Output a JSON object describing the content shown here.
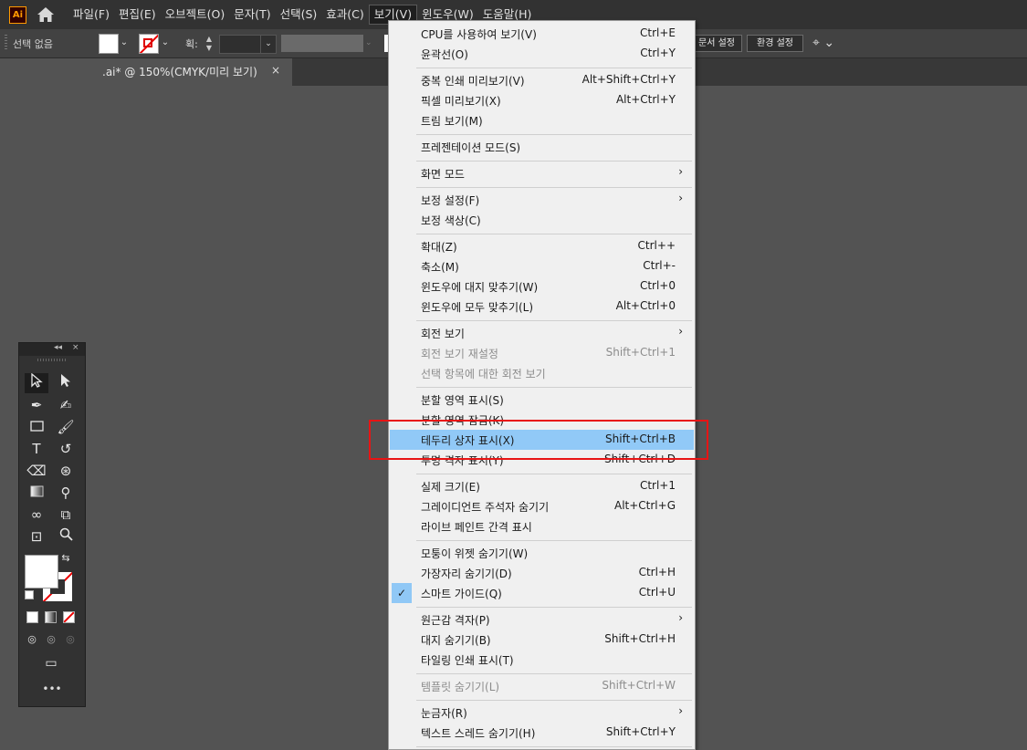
{
  "app": {
    "logo": "Ai"
  },
  "menubar": {
    "items": [
      "파일(F)",
      "편집(E)",
      "오브젝트(O)",
      "문자(T)",
      "선택(S)",
      "효과(C)",
      "보기(V)",
      "윈도우(W)",
      "도움말(H)"
    ]
  },
  "controlbar": {
    "selection_label": "선택 없음",
    "stroke_label": "획:",
    "doc_setup_button": "문서 설정",
    "preferences_button": "환경 설정"
  },
  "tab": {
    "title": ".ai* @ 150%(CMYK/미리 보기)",
    "close": "×"
  },
  "tools_panel": {
    "collapse": "◂◂",
    "close": "×",
    "more": "•••"
  },
  "view_menu": {
    "items": [
      {
        "label": "CPU를 사용하여 보기(V)",
        "shortcut": "Ctrl+E"
      },
      {
        "label": "윤곽선(O)",
        "shortcut": "Ctrl+Y"
      },
      {
        "label": "중복 인쇄 미리보기(V)",
        "shortcut": "Alt+Shift+Ctrl+Y"
      },
      {
        "label": "픽셀 미리보기(X)",
        "shortcut": "Alt+Ctrl+Y"
      },
      {
        "label": "트림 보기(M)",
        "shortcut": ""
      },
      {
        "label": "프레젠테이션 모드(S)",
        "shortcut": ""
      },
      {
        "label": "화면 모드",
        "shortcut": ""
      },
      {
        "label": "보정 설정(F)",
        "shortcut": ""
      },
      {
        "label": "보정 색상(C)",
        "shortcut": ""
      },
      {
        "label": "확대(Z)",
        "shortcut": "Ctrl++"
      },
      {
        "label": "축소(M)",
        "shortcut": "Ctrl+-"
      },
      {
        "label": "윈도우에 대지 맞추기(W)",
        "shortcut": "Ctrl+0"
      },
      {
        "label": "윈도우에 모두 맞추기(L)",
        "shortcut": "Alt+Ctrl+0"
      },
      {
        "label": "회전 보기",
        "shortcut": ""
      },
      {
        "label": "회전 보기 재설정",
        "shortcut": "Shift+Ctrl+1"
      },
      {
        "label": "선택 항목에 대한 회전 보기",
        "shortcut": ""
      },
      {
        "label": "분할 영역 표시(S)",
        "shortcut": ""
      },
      {
        "label": "분할 영역 잠금(K)",
        "shortcut": ""
      },
      {
        "label": "테두리 상자 표시(X)",
        "shortcut": "Shift+Ctrl+B"
      },
      {
        "label": "투명 격자 표시(Y)",
        "shortcut": "Shift+Ctrl+D"
      },
      {
        "label": "실제 크기(E)",
        "shortcut": "Ctrl+1"
      },
      {
        "label": "그레이디언트 주석자 숨기기",
        "shortcut": "Alt+Ctrl+G"
      },
      {
        "label": "라이브 페인트 간격 표시",
        "shortcut": ""
      },
      {
        "label": "모퉁이 위젯 숨기기(W)",
        "shortcut": ""
      },
      {
        "label": "가장자리 숨기기(D)",
        "shortcut": "Ctrl+H"
      },
      {
        "label": "스마트 가이드(Q)",
        "shortcut": "Ctrl+U"
      },
      {
        "label": "원근감 격자(P)",
        "shortcut": ""
      },
      {
        "label": "대지 숨기기(B)",
        "shortcut": "Shift+Ctrl+H"
      },
      {
        "label": "타일링 인쇄 표시(T)",
        "shortcut": ""
      },
      {
        "label": "템플릿 숨기기(L)",
        "shortcut": "Shift+Ctrl+W"
      },
      {
        "label": "눈금자(R)",
        "shortcut": ""
      },
      {
        "label": "텍스트 스레드 숨기기(H)",
        "shortcut": "Shift+Ctrl+Y"
      }
    ],
    "submenu_arrow": "›",
    "check": "✓"
  }
}
